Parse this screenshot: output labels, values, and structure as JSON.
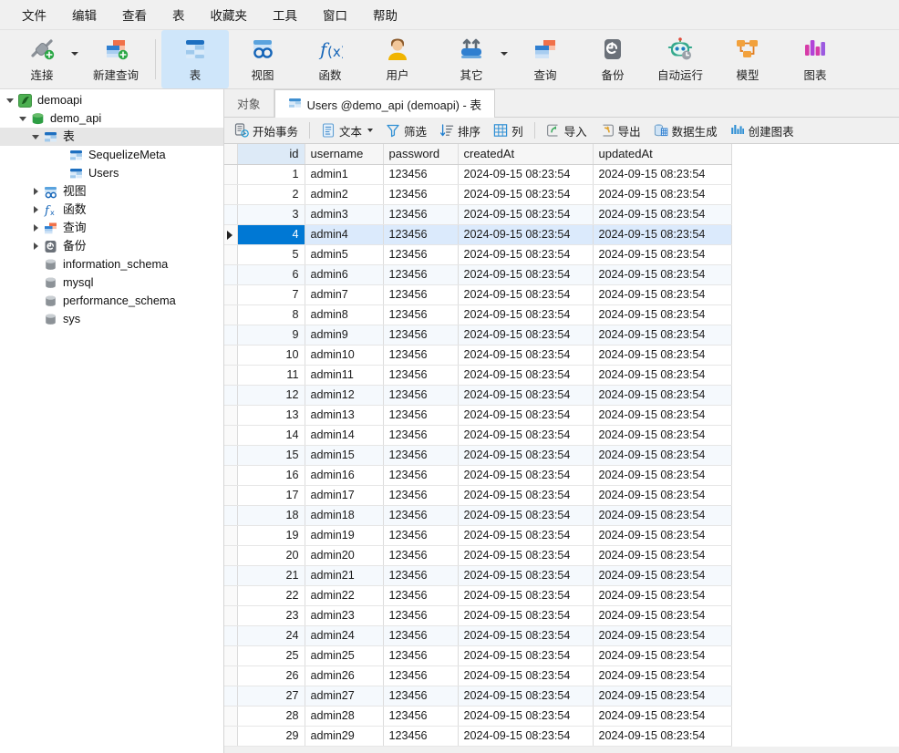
{
  "menubar": {
    "items": [
      {
        "label": "文件",
        "name": "menu-file"
      },
      {
        "label": "编辑",
        "name": "menu-edit"
      },
      {
        "label": "查看",
        "name": "menu-view"
      },
      {
        "label": "表",
        "name": "menu-table"
      },
      {
        "label": "收藏夹",
        "name": "menu-favorites"
      },
      {
        "label": "工具",
        "name": "menu-tools"
      },
      {
        "label": "窗口",
        "name": "menu-window"
      },
      {
        "label": "帮助",
        "name": "menu-help"
      }
    ]
  },
  "ribbon": {
    "items": [
      {
        "label": "连接",
        "icon": "connection-icon",
        "selected": false,
        "dropdown": true
      },
      {
        "label": "新建查询",
        "icon": "new-query-icon",
        "selected": false,
        "dropdown": false
      },
      {
        "label": "表",
        "icon": "table-icon",
        "selected": true,
        "dropdown": false
      },
      {
        "label": "视图",
        "icon": "view-icon",
        "selected": false,
        "dropdown": false
      },
      {
        "label": "函数",
        "icon": "function-icon",
        "selected": false,
        "dropdown": false
      },
      {
        "label": "用户",
        "icon": "user-icon",
        "selected": false,
        "dropdown": false
      },
      {
        "label": "其它",
        "icon": "others-icon",
        "selected": false,
        "dropdown": true
      },
      {
        "label": "查询",
        "icon": "query-icon",
        "selected": false,
        "dropdown": false
      },
      {
        "label": "备份",
        "icon": "backup-icon",
        "selected": false,
        "dropdown": false
      },
      {
        "label": "自动运行",
        "icon": "automation-icon",
        "selected": false,
        "dropdown": false
      },
      {
        "label": "模型",
        "icon": "model-icon",
        "selected": false,
        "dropdown": false
      },
      {
        "label": "图表",
        "icon": "chart-icon",
        "selected": false,
        "dropdown": false
      }
    ]
  },
  "sidebar": {
    "nodes": [
      {
        "label": "demoapi",
        "indent": 0,
        "twist": "open",
        "icon": "connection-node-icon",
        "selected": false
      },
      {
        "label": "demo_api",
        "indent": 1,
        "twist": "open",
        "icon": "database-green-icon",
        "selected": false
      },
      {
        "label": "表",
        "indent": 2,
        "twist": "open",
        "icon": "table-folder-icon",
        "selected": true
      },
      {
        "label": "SequelizeMeta",
        "indent": 4,
        "twist": "none",
        "icon": "table-item-icon",
        "selected": false
      },
      {
        "label": "Users",
        "indent": 4,
        "twist": "none",
        "icon": "table-item-icon",
        "selected": false
      },
      {
        "label": "视图",
        "indent": 2,
        "twist": "closed",
        "icon": "view-folder-icon",
        "selected": false
      },
      {
        "label": "函数",
        "indent": 2,
        "twist": "closed",
        "icon": "function-folder-icon",
        "selected": false
      },
      {
        "label": "查询",
        "indent": 2,
        "twist": "closed",
        "icon": "query-folder-icon",
        "selected": false
      },
      {
        "label": "备份",
        "indent": 2,
        "twist": "closed",
        "icon": "backup-folder-icon",
        "selected": false
      },
      {
        "label": "information_schema",
        "indent": 2,
        "twist": "none",
        "icon": "database-gray-icon",
        "selected": false
      },
      {
        "label": "mysql",
        "indent": 2,
        "twist": "none",
        "icon": "database-gray-icon",
        "selected": false
      },
      {
        "label": "performance_schema",
        "indent": 2,
        "twist": "none",
        "icon": "database-gray-icon",
        "selected": false
      },
      {
        "label": "sys",
        "indent": 2,
        "twist": "none",
        "icon": "database-gray-icon",
        "selected": false
      }
    ]
  },
  "tabs": [
    {
      "label": "对象",
      "icon": "none",
      "active": false,
      "name": "tab-objects"
    },
    {
      "label": "Users @demo_api (demoapi) - 表",
      "icon": "table-icon",
      "active": true,
      "name": "tab-users-table"
    }
  ],
  "data_toolbar": {
    "buttons": [
      {
        "label": "开始事务",
        "icon": "transaction-icon",
        "dropdown": false,
        "name": "begin-transaction-button"
      },
      {
        "label": "文本",
        "icon": "text-icon",
        "dropdown": true,
        "name": "text-view-button"
      },
      {
        "label": "筛选",
        "icon": "filter-icon",
        "dropdown": false,
        "name": "filter-button"
      },
      {
        "label": "排序",
        "icon": "sort-icon",
        "dropdown": false,
        "name": "sort-button"
      },
      {
        "label": "列",
        "icon": "columns-icon",
        "dropdown": false,
        "name": "columns-button"
      },
      {
        "label": "导入",
        "icon": "import-icon",
        "dropdown": false,
        "name": "import-button"
      },
      {
        "label": "导出",
        "icon": "export-icon",
        "dropdown": false,
        "name": "export-button"
      },
      {
        "label": "数据生成",
        "icon": "data-generate-icon",
        "dropdown": false,
        "name": "data-generation-button"
      },
      {
        "label": "创建图表",
        "icon": "create-chart-icon",
        "dropdown": false,
        "name": "create-chart-button"
      }
    ],
    "separators_after": [
      0,
      4
    ]
  },
  "grid": {
    "columns": [
      {
        "key": "id",
        "label": "id",
        "active": true,
        "align": "right"
      },
      {
        "key": "username",
        "label": "username",
        "active": false,
        "align": "left"
      },
      {
        "key": "password",
        "label": "password",
        "active": false,
        "align": "left"
      },
      {
        "key": "createdAt",
        "label": "createdAt",
        "active": false,
        "align": "left"
      },
      {
        "key": "updatedAt",
        "label": "updatedAt",
        "active": false,
        "align": "left"
      }
    ],
    "selected_row_id": 4,
    "rows": [
      {
        "id": 1,
        "username": "admin1",
        "password": "123456",
        "createdAt": "2024-09-15 08:23:54",
        "updatedAt": "2024-09-15 08:23:54"
      },
      {
        "id": 2,
        "username": "admin2",
        "password": "123456",
        "createdAt": "2024-09-15 08:23:54",
        "updatedAt": "2024-09-15 08:23:54"
      },
      {
        "id": 3,
        "username": "admin3",
        "password": "123456",
        "createdAt": "2024-09-15 08:23:54",
        "updatedAt": "2024-09-15 08:23:54"
      },
      {
        "id": 4,
        "username": "admin4",
        "password": "123456",
        "createdAt": "2024-09-15 08:23:54",
        "updatedAt": "2024-09-15 08:23:54"
      },
      {
        "id": 5,
        "username": "admin5",
        "password": "123456",
        "createdAt": "2024-09-15 08:23:54",
        "updatedAt": "2024-09-15 08:23:54"
      },
      {
        "id": 6,
        "username": "admin6",
        "password": "123456",
        "createdAt": "2024-09-15 08:23:54",
        "updatedAt": "2024-09-15 08:23:54"
      },
      {
        "id": 7,
        "username": "admin7",
        "password": "123456",
        "createdAt": "2024-09-15 08:23:54",
        "updatedAt": "2024-09-15 08:23:54"
      },
      {
        "id": 8,
        "username": "admin8",
        "password": "123456",
        "createdAt": "2024-09-15 08:23:54",
        "updatedAt": "2024-09-15 08:23:54"
      },
      {
        "id": 9,
        "username": "admin9",
        "password": "123456",
        "createdAt": "2024-09-15 08:23:54",
        "updatedAt": "2024-09-15 08:23:54"
      },
      {
        "id": 10,
        "username": "admin10",
        "password": "123456",
        "createdAt": "2024-09-15 08:23:54",
        "updatedAt": "2024-09-15 08:23:54"
      },
      {
        "id": 11,
        "username": "admin11",
        "password": "123456",
        "createdAt": "2024-09-15 08:23:54",
        "updatedAt": "2024-09-15 08:23:54"
      },
      {
        "id": 12,
        "username": "admin12",
        "password": "123456",
        "createdAt": "2024-09-15 08:23:54",
        "updatedAt": "2024-09-15 08:23:54"
      },
      {
        "id": 13,
        "username": "admin13",
        "password": "123456",
        "createdAt": "2024-09-15 08:23:54",
        "updatedAt": "2024-09-15 08:23:54"
      },
      {
        "id": 14,
        "username": "admin14",
        "password": "123456",
        "createdAt": "2024-09-15 08:23:54",
        "updatedAt": "2024-09-15 08:23:54"
      },
      {
        "id": 15,
        "username": "admin15",
        "password": "123456",
        "createdAt": "2024-09-15 08:23:54",
        "updatedAt": "2024-09-15 08:23:54"
      },
      {
        "id": 16,
        "username": "admin16",
        "password": "123456",
        "createdAt": "2024-09-15 08:23:54",
        "updatedAt": "2024-09-15 08:23:54"
      },
      {
        "id": 17,
        "username": "admin17",
        "password": "123456",
        "createdAt": "2024-09-15 08:23:54",
        "updatedAt": "2024-09-15 08:23:54"
      },
      {
        "id": 18,
        "username": "admin18",
        "password": "123456",
        "createdAt": "2024-09-15 08:23:54",
        "updatedAt": "2024-09-15 08:23:54"
      },
      {
        "id": 19,
        "username": "admin19",
        "password": "123456",
        "createdAt": "2024-09-15 08:23:54",
        "updatedAt": "2024-09-15 08:23:54"
      },
      {
        "id": 20,
        "username": "admin20",
        "password": "123456",
        "createdAt": "2024-09-15 08:23:54",
        "updatedAt": "2024-09-15 08:23:54"
      },
      {
        "id": 21,
        "username": "admin21",
        "password": "123456",
        "createdAt": "2024-09-15 08:23:54",
        "updatedAt": "2024-09-15 08:23:54"
      },
      {
        "id": 22,
        "username": "admin22",
        "password": "123456",
        "createdAt": "2024-09-15 08:23:54",
        "updatedAt": "2024-09-15 08:23:54"
      },
      {
        "id": 23,
        "username": "admin23",
        "password": "123456",
        "createdAt": "2024-09-15 08:23:54",
        "updatedAt": "2024-09-15 08:23:54"
      },
      {
        "id": 24,
        "username": "admin24",
        "password": "123456",
        "createdAt": "2024-09-15 08:23:54",
        "updatedAt": "2024-09-15 08:23:54"
      },
      {
        "id": 25,
        "username": "admin25",
        "password": "123456",
        "createdAt": "2024-09-15 08:23:54",
        "updatedAt": "2024-09-15 08:23:54"
      },
      {
        "id": 26,
        "username": "admin26",
        "password": "123456",
        "createdAt": "2024-09-15 08:23:54",
        "updatedAt": "2024-09-15 08:23:54"
      },
      {
        "id": 27,
        "username": "admin27",
        "password": "123456",
        "createdAt": "2024-09-15 08:23:54",
        "updatedAt": "2024-09-15 08:23:54"
      },
      {
        "id": 28,
        "username": "admin28",
        "password": "123456",
        "createdAt": "2024-09-15 08:23:54",
        "updatedAt": "2024-09-15 08:23:54"
      },
      {
        "id": 29,
        "username": "admin29",
        "password": "123456",
        "createdAt": "2024-09-15 08:23:54",
        "updatedAt": "2024-09-15 08:23:54"
      }
    ]
  },
  "colors": {
    "accent": "#0078d4",
    "selection": "#dbeafc",
    "ribbon_selected": "#cfe6fa",
    "chrome": "#f0f0f0",
    "alt_row": "#f5f9fd"
  }
}
